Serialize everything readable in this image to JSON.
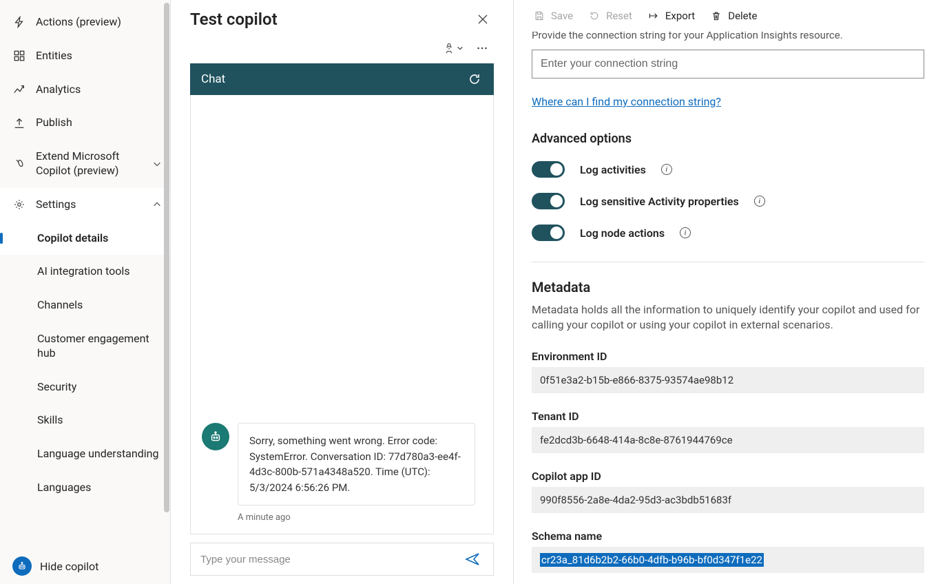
{
  "sidebar": {
    "items": [
      {
        "label": "Actions (preview)"
      },
      {
        "label": "Entities"
      },
      {
        "label": "Analytics"
      },
      {
        "label": "Publish"
      },
      {
        "label": "Extend Microsoft Copilot (preview)"
      },
      {
        "label": "Settings"
      }
    ],
    "settingsChildren": [
      {
        "label": "Copilot details"
      },
      {
        "label": "AI integration tools"
      },
      {
        "label": "Channels"
      },
      {
        "label": "Customer engagement hub"
      },
      {
        "label": "Security"
      },
      {
        "label": "Skills"
      },
      {
        "label": "Language understanding"
      },
      {
        "label": "Languages"
      }
    ],
    "hideCopilot": "Hide copilot"
  },
  "testPanel": {
    "title": "Test copilot",
    "chatHeader": "Chat",
    "botMessage": "Sorry, something went wrong. Error code: SystemError. Conversation ID: 77d780a3-ee4f-4d3c-800b-571a4348a520. Time (UTC): 5/3/2024 6:56:26 PM.",
    "messageTime": "A minute ago",
    "inputPlaceholder": "Type your message"
  },
  "commandBar": {
    "save": "Save",
    "reset": "Reset",
    "export": "Export",
    "delete": "Delete"
  },
  "content": {
    "connDescription": "Provide the connection string for your Application Insights resource.",
    "connPlaceholder": "Enter your connection string",
    "connLink": "Where can I find my connection string?",
    "advTitle": "Advanced options",
    "toggles": [
      {
        "label": "Log activities"
      },
      {
        "label": "Log sensitive Activity properties"
      },
      {
        "label": "Log node actions"
      }
    ],
    "metadataTitle": "Metadata",
    "metadataDesc": "Metadata holds all the information to uniquely identify your copilot and used for calling your copilot or using your copilot in external scenarios.",
    "fields": {
      "envIdLabel": "Environment ID",
      "envIdValue": "0f51e3a2-b15b-e866-8375-93574ae98b12",
      "tenantIdLabel": "Tenant ID",
      "tenantIdValue": "fe2dcd3b-6648-414a-8c8e-8761944769ce",
      "appIdLabel": "Copilot app ID",
      "appIdValue": "990f8556-2a8e-4da2-95d3-ac3bdb51683f",
      "schemaLabel": "Schema name",
      "schemaValue": "cr23a_81d6b2b2-66b0-4dfb-b96b-bf0d347f1e22"
    }
  }
}
